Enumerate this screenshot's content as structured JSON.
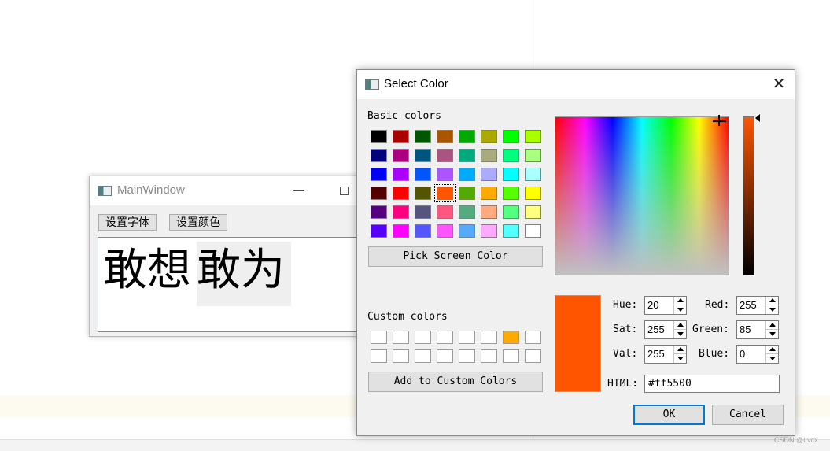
{
  "main_window": {
    "title": "MainWindow",
    "font_button_label": "设置字体",
    "color_button_label": "设置颜色",
    "text_normal": "敢想",
    "text_selected": "敢为"
  },
  "dialog": {
    "title": "Select Color",
    "basic_colors_label": "Basic colors",
    "basic_colors": [
      [
        "#000000",
        "#aa0000",
        "#005500",
        "#aa5500",
        "#00aa00",
        "#aaaa00",
        "#00ff00",
        "#aaff00"
      ],
      [
        "#00007f",
        "#aa007f",
        "#00557f",
        "#aa557f",
        "#00aa7f",
        "#aaaa7f",
        "#00ff7f",
        "#aaff7f"
      ],
      [
        "#0000ff",
        "#aa00ff",
        "#0055ff",
        "#aa55ff",
        "#00aaff",
        "#aaaaff",
        "#00ffff",
        "#aaffff"
      ],
      [
        "#550000",
        "#ff0000",
        "#555500",
        "#ff5500",
        "#55aa00",
        "#ffaa00",
        "#55ff00",
        "#ffff00"
      ],
      [
        "#55007f",
        "#ff007f",
        "#55557f",
        "#ff557f",
        "#55aa7f",
        "#ffaa7f",
        "#55ff7f",
        "#ffff7f"
      ],
      [
        "#5500ff",
        "#ff00ff",
        "#5555ff",
        "#ff55ff",
        "#55aaff",
        "#ffaaff",
        "#55ffff",
        "#ffffff"
      ]
    ],
    "selected_basic_index": [
      3,
      3
    ],
    "pick_screen_label": "Pick Screen Color",
    "custom_colors_label": "Custom colors",
    "custom_colors": [
      [
        "#ffffff",
        "#ffffff",
        "#ffffff",
        "#ffffff",
        "#ffffff",
        "#ffffff",
        "#ffaa00",
        "#ffffff"
      ],
      [
        "#ffffff",
        "#ffffff",
        "#ffffff",
        "#ffffff",
        "#ffffff",
        "#ffffff",
        "#ffffff",
        "#ffffff"
      ]
    ],
    "add_custom_label": "Add to Custom Colors",
    "current_color": "#ff5500",
    "fields": {
      "hue_label": "Hue:",
      "hue": "20",
      "sat_label": "Sat:",
      "sat": "255",
      "val_label": "Val:",
      "val": "255",
      "red_label": "Red:",
      "red": "255",
      "green_label": "Green:",
      "green": "85",
      "blue_label": "Blue:",
      "blue": "0",
      "html_label": "HTML:",
      "html": "#ff5500"
    },
    "ok_label": "OK",
    "cancel_label": "Cancel"
  },
  "watermark": "CSDN @Lvcx"
}
